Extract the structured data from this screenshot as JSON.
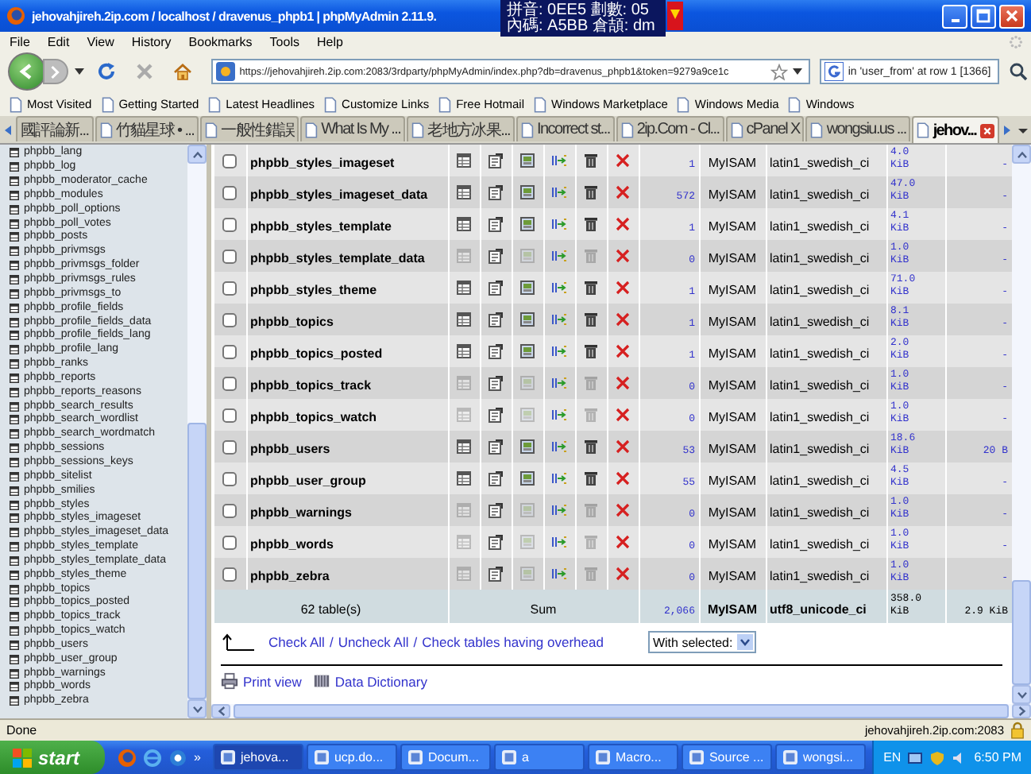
{
  "window": {
    "title": "jehovahjireh.2ip.com / localhost / dravenus_phpb1 | phpMyAdmin 2.11.9.",
    "ime_popup": [
      "拼音: 0EE5 劃數: 05",
      "內碼: A5BB 倉頡: dm"
    ]
  },
  "menu": [
    "File",
    "Edit",
    "View",
    "History",
    "Bookmarks",
    "Tools",
    "Help"
  ],
  "address": {
    "url": "https://jehovahjireh.2ip.com:2083/3rdparty/phpMyAdmin/index.php?db=dravenus_phpb1&token=9279a9ce1c"
  },
  "search": {
    "value": "in 'user_from' at row 1 [1366]"
  },
  "bookmarks": [
    "Most Visited",
    "Getting Started",
    "Latest Headlines",
    "Customize Links",
    "Free Hotmail",
    "Windows Marketplace",
    "Windows Media",
    "Windows"
  ],
  "tabs": [
    {
      "label": "國評論新...",
      "selected": false
    },
    {
      "label": "竹貓星球 • ...",
      "selected": false
    },
    {
      "label": "一般性錯誤",
      "selected": false
    },
    {
      "label": "What Is My ...",
      "selected": false
    },
    {
      "label": "老地方冰果...",
      "selected": false
    },
    {
      "label": "Incorrect st...",
      "selected": false
    },
    {
      "label": "2ip.Com - Cl...",
      "selected": false
    },
    {
      "label": "cPanel X",
      "selected": false
    },
    {
      "label": "wongsiu.us ...",
      "selected": false
    },
    {
      "label": "jehov...",
      "selected": true
    }
  ],
  "sidebar": {
    "items": [
      "phpbb_lang",
      "phpbb_log",
      "phpbb_moderator_cache",
      "phpbb_modules",
      "phpbb_poll_options",
      "phpbb_poll_votes",
      "phpbb_posts",
      "phpbb_privmsgs",
      "phpbb_privmsgs_folder",
      "phpbb_privmsgs_rules",
      "phpbb_privmsgs_to",
      "phpbb_profile_fields",
      "phpbb_profile_fields_data",
      "phpbb_profile_fields_lang",
      "phpbb_profile_lang",
      "phpbb_ranks",
      "phpbb_reports",
      "phpbb_reports_reasons",
      "phpbb_search_results",
      "phpbb_search_wordlist",
      "phpbb_search_wordmatch",
      "phpbb_sessions",
      "phpbb_sessions_keys",
      "phpbb_sitelist",
      "phpbb_smilies",
      "phpbb_styles",
      "phpbb_styles_imageset",
      "phpbb_styles_imageset_data",
      "phpbb_styles_template",
      "phpbb_styles_template_data",
      "phpbb_styles_theme",
      "phpbb_topics",
      "phpbb_topics_posted",
      "phpbb_topics_track",
      "phpbb_topics_watch",
      "phpbb_users",
      "phpbb_user_group",
      "phpbb_warnings",
      "phpbb_words",
      "phpbb_zebra"
    ]
  },
  "table": {
    "rows": [
      {
        "name": "phpbb_styles_imageset",
        "checked": false,
        "empty": false,
        "records": "1",
        "type": "MyISAM",
        "collation": "latin1_swedish_ci",
        "size": "4.0 KiB",
        "overhead": "-"
      },
      {
        "name": "phpbb_styles_imageset_data",
        "checked": false,
        "empty": false,
        "records": "572",
        "type": "MyISAM",
        "collation": "latin1_swedish_ci",
        "size": "47.0 KiB",
        "overhead": "-"
      },
      {
        "name": "phpbb_styles_template",
        "checked": false,
        "empty": false,
        "records": "1",
        "type": "MyISAM",
        "collation": "latin1_swedish_ci",
        "size": "4.1 KiB",
        "overhead": "-"
      },
      {
        "name": "phpbb_styles_template_data",
        "checked": false,
        "empty": true,
        "records": "0",
        "type": "MyISAM",
        "collation": "latin1_swedish_ci",
        "size": "1.0 KiB",
        "overhead": "-"
      },
      {
        "name": "phpbb_styles_theme",
        "checked": false,
        "empty": false,
        "records": "1",
        "type": "MyISAM",
        "collation": "latin1_swedish_ci",
        "size": "71.0 KiB",
        "overhead": "-"
      },
      {
        "name": "phpbb_topics",
        "checked": false,
        "empty": false,
        "records": "1",
        "type": "MyISAM",
        "collation": "latin1_swedish_ci",
        "size": "8.1 KiB",
        "overhead": "-"
      },
      {
        "name": "phpbb_topics_posted",
        "checked": false,
        "empty": false,
        "records": "1",
        "type": "MyISAM",
        "collation": "latin1_swedish_ci",
        "size": "2.0 KiB",
        "overhead": "-"
      },
      {
        "name": "phpbb_topics_track",
        "checked": false,
        "empty": true,
        "records": "0",
        "type": "MyISAM",
        "collation": "latin1_swedish_ci",
        "size": "1.0 KiB",
        "overhead": "-"
      },
      {
        "name": "phpbb_topics_watch",
        "checked": false,
        "empty": true,
        "records": "0",
        "type": "MyISAM",
        "collation": "latin1_swedish_ci",
        "size": "1.0 KiB",
        "overhead": "-"
      },
      {
        "name": "phpbb_users",
        "checked": false,
        "empty": false,
        "records": "53",
        "type": "MyISAM",
        "collation": "latin1_swedish_ci",
        "size": "18.6 KiB",
        "overhead": "20 B"
      },
      {
        "name": "phpbb_user_group",
        "checked": false,
        "empty": false,
        "records": "55",
        "type": "MyISAM",
        "collation": "latin1_swedish_ci",
        "size": "4.5 KiB",
        "overhead": "-"
      },
      {
        "name": "phpbb_warnings",
        "checked": false,
        "empty": true,
        "records": "0",
        "type": "MyISAM",
        "collation": "latin1_swedish_ci",
        "size": "1.0 KiB",
        "overhead": "-"
      },
      {
        "name": "phpbb_words",
        "checked": false,
        "empty": true,
        "records": "0",
        "type": "MyISAM",
        "collation": "latin1_swedish_ci",
        "size": "1.0 KiB",
        "overhead": "-"
      },
      {
        "name": "phpbb_zebra",
        "checked": false,
        "empty": true,
        "records": "0",
        "type": "MyISAM",
        "collation": "latin1_swedish_ci",
        "size": "1.0 KiB",
        "overhead": "-"
      }
    ],
    "summary": {
      "tables": "62 table(s)",
      "label": "Sum",
      "records": "2,066",
      "type": "MyISAM",
      "collation": "utf8_unicode_ci",
      "size": "358.0 KiB",
      "overhead": "2.9 KiB"
    }
  },
  "actions": {
    "links": [
      "Check All",
      "Uncheck All",
      "Check tables having overhead"
    ],
    "separator": "/",
    "with_selected": "With selected:"
  },
  "footer_links": [
    "Print view",
    "Data Dictionary"
  ],
  "status_bar": {
    "text": "Done",
    "host": "jehovahjireh.2ip.com:2083"
  },
  "taskbar": {
    "start": "start",
    "more": "»",
    "tasks": [
      {
        "label": "jehova...",
        "selected": true
      },
      {
        "label": "ucp.do...",
        "selected": false
      },
      {
        "label": "Docum...",
        "selected": false
      },
      {
        "label": "a",
        "selected": false
      },
      {
        "label": "Macro...",
        "selected": false
      },
      {
        "label": "Source ...",
        "selected": false
      },
      {
        "label": "wongsi...",
        "selected": false
      }
    ],
    "language": "EN",
    "clock": "6:50 PM"
  }
}
